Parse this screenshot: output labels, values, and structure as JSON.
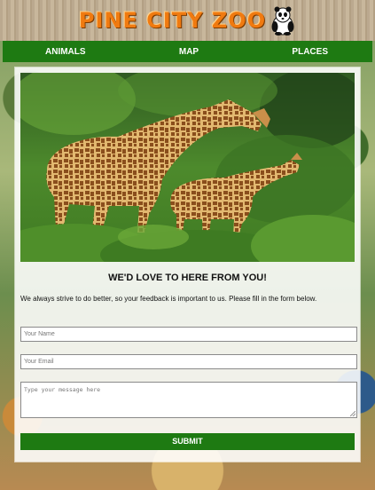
{
  "header": {
    "logo_text": "PINE CITY ZOO",
    "logo_icon": "panda-icon"
  },
  "nav": {
    "items": [
      {
        "label": "ANIMALS"
      },
      {
        "label": "MAP"
      },
      {
        "label": "PLACES"
      }
    ]
  },
  "main": {
    "hero_image": "giraffes-photo",
    "heading": "WE'D LOVE TO HERE FROM YOU!",
    "intro": "We always strive to do better, so your feedback is important to us. Please fill in the form below.",
    "form": {
      "name_placeholder": "Your Name",
      "email_placeholder": "Your Email",
      "message_placeholder": "Type your message here",
      "submit_label": "SUBMIT"
    }
  },
  "colors": {
    "nav_green": "#1e7a12",
    "logo_orange": "#f07a10"
  }
}
